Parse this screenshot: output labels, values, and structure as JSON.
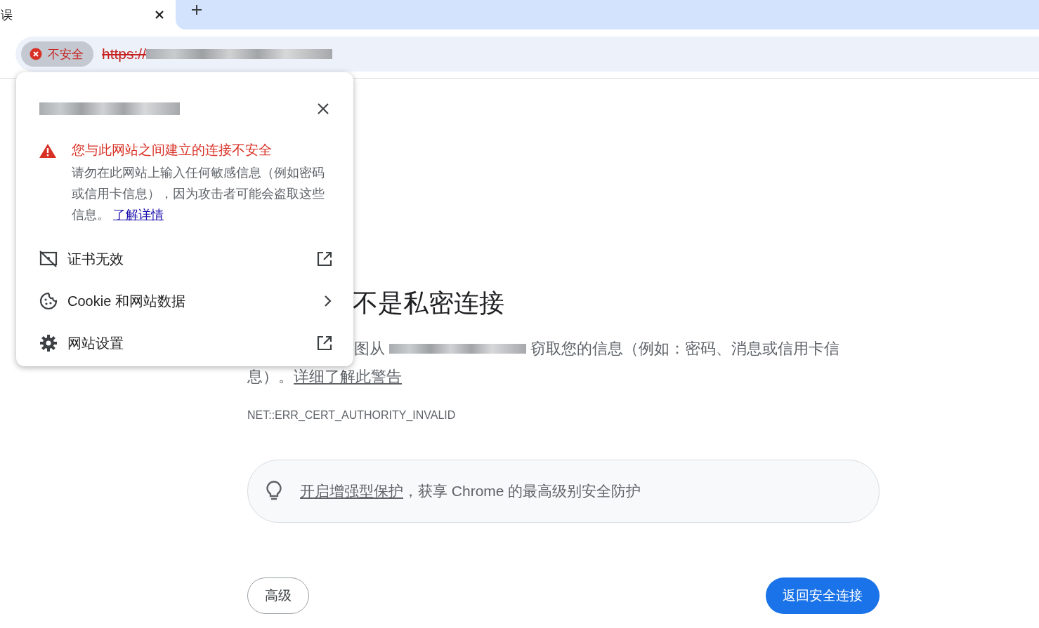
{
  "tabs": [
    {
      "title": "误",
      "selected": true
    }
  ],
  "omnibox": {
    "security_chip": "不安全",
    "scheme": "https://"
  },
  "popup": {
    "warning_title": "您与此网站之间建立的连接不安全",
    "warning_text": "请勿在此网站上输入任何敏感信息（例如密码或信用卡信息），因为攻击者可能会盗取这些信息。",
    "learn_more": "了解详情",
    "items": [
      {
        "kind": "external",
        "label": "证书无效"
      },
      {
        "kind": "submenu",
        "label": "Cookie 和网站数据"
      },
      {
        "kind": "external",
        "label": "网站设置"
      }
    ]
  },
  "page": {
    "heading": "不是私密连接",
    "text_before_site": "图从",
    "text_after_site": "窃取您的信息（例如：密码、消息或信用卡信息）。",
    "warning_link": "详细了解此警告",
    "error_code": "NET::ERR_CERT_AUTHORITY_INVALID",
    "promo_link": "开启增强型保护",
    "promo_text": "，获享 Chrome 的最高级别安全防护",
    "buttons": [
      {
        "kind": "secondary",
        "label": "高级"
      },
      {
        "kind": "primary",
        "label": "返回安全连接"
      }
    ]
  }
}
